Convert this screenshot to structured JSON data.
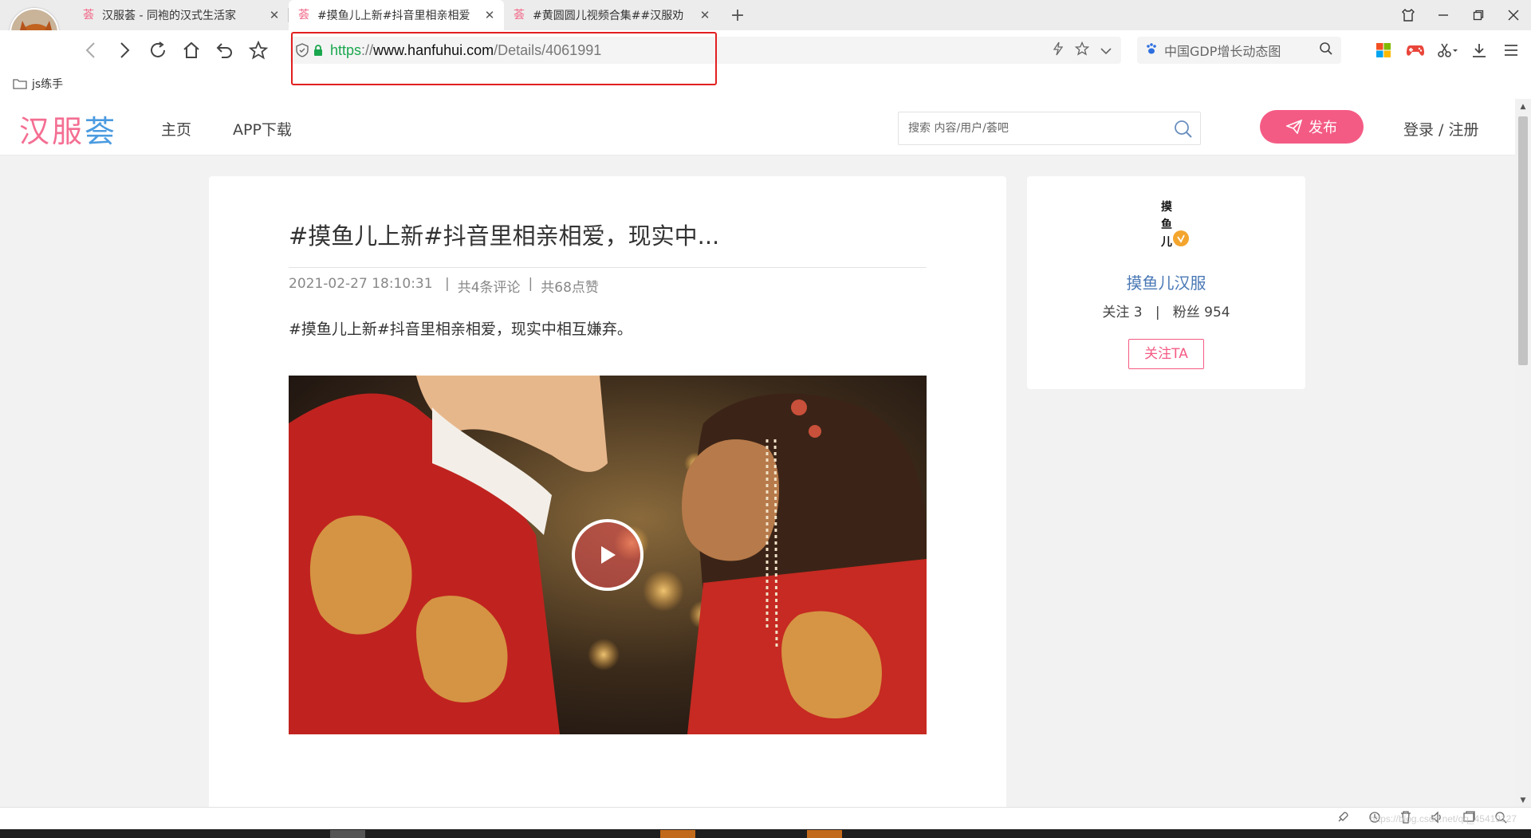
{
  "browser": {
    "tabs": [
      {
        "title": "汉服荟 - 同袍的汉式生活家",
        "active": false
      },
      {
        "title": "#摸鱼儿上新#抖音里相亲相爱",
        "active": true
      },
      {
        "title": "#黄圆圆儿视频合集##汉服劝",
        "active": false
      }
    ],
    "new_tab": "+",
    "close_glyph": "✕",
    "url": {
      "scheme": "https",
      "sep": "://",
      "host": "www.hanfuhui.com",
      "path": "/Details/4061991"
    },
    "search_text": "中国GDP增长动态图",
    "bookmark": "js练手",
    "accent_highlight": "#e21f1f"
  },
  "site": {
    "logo": {
      "c1": "汉",
      "c2": "服",
      "c3": "荟"
    },
    "nav": {
      "home": "主页",
      "app": "APP下载"
    },
    "search_placeholder": "搜索 内容/用户/荟吧",
    "publish": "发布",
    "login": "登录 / 注册",
    "brand_color": "#f45b84"
  },
  "post": {
    "title": "#摸鱼儿上新#抖音里相亲相爱，现实中...",
    "date": "2021-02-27 18:10:31",
    "comments": "共4条评论",
    "likes": "共68点赞",
    "body": "#摸鱼儿上新#抖音里相亲相爱，现实中相互嫌弃。"
  },
  "author": {
    "avatar_chars": [
      "摸",
      "鱼",
      "儿"
    ],
    "name": "摸鱼儿汉服",
    "following": "关注 3",
    "stat_sep": "|",
    "fans": "粉丝 954",
    "follow_btn": "关注TA"
  },
  "statusbar": {
    "watermark": "https://blog.csdn.net/qq_45419127"
  }
}
